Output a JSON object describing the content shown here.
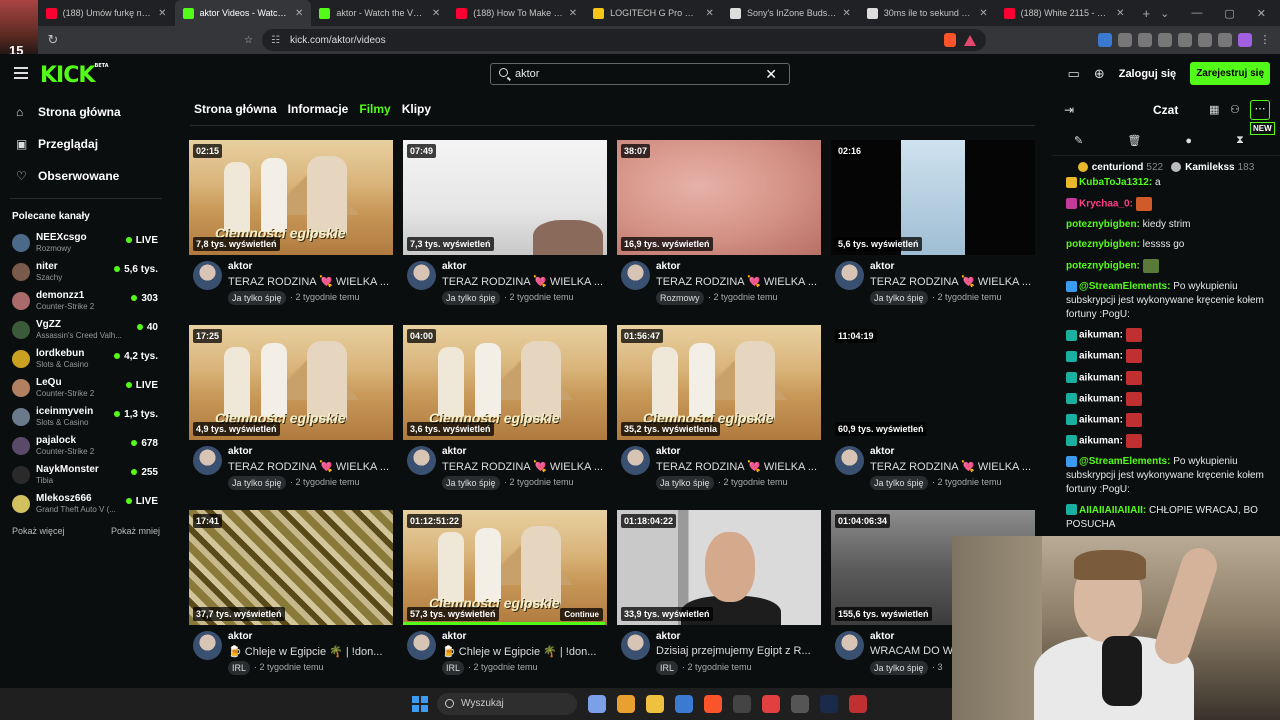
{
  "browser": {
    "tabs": [
      {
        "title": "(188) Umów furkę na najlepsze",
        "color": "#ff0033",
        "active": false
      },
      {
        "title": "aktor Videos - Watch On",
        "color": "#53fc18",
        "active": true
      },
      {
        "title": "aktor - Watch the VOD on Kick",
        "color": "#53fc18",
        "active": false
      },
      {
        "title": "(188) How To Make Ribs on a",
        "color": "#ff0033",
        "active": false
      },
      {
        "title": "LOGITECH G Pro X 2 Bezprzew",
        "color": "#f5c518",
        "active": false
      },
      {
        "title": "Sony's InZone Buds jakie mają",
        "color": "#dddddd",
        "active": false
      },
      {
        "title": "30ms ile to sekund - Google S",
        "color": "#dddddd",
        "active": false
      },
      {
        "title": "(188) White 2115 - RED FLAG",
        "color": "#ff0033",
        "active": false
      }
    ],
    "avatar_level": "15",
    "url": "kick.com/aktor/videos"
  },
  "header": {
    "logo": "KICK",
    "logo_beta": "BETA",
    "search_value": "aktor",
    "login": "Zaloguj się",
    "signup": "Zarejestruj się"
  },
  "sidebar": {
    "nav": [
      {
        "icon": "home-icon",
        "label": "Strona główna",
        "glyph": "⌂"
      },
      {
        "icon": "browse-icon",
        "label": "Przeglądaj",
        "glyph": "▣"
      },
      {
        "icon": "heart-icon",
        "label": "Obserwowane",
        "glyph": "♡"
      }
    ],
    "section_title": "Polecane kanały",
    "channels": [
      {
        "name": "NEEXcsgo",
        "game": "Rozmowy",
        "viewers": "LIVE",
        "color": "#4a6a8a"
      },
      {
        "name": "niter",
        "game": "Szachy",
        "viewers": "5,6 tys.",
        "color": "#7a5a4a"
      },
      {
        "name": "demonzz1",
        "game": "Counter-Strike 2",
        "viewers": "303",
        "color": "#a86a6a"
      },
      {
        "name": "VgZZ",
        "game": "Assassin's Creed Valh...",
        "viewers": "40",
        "color": "#3a5a3a"
      },
      {
        "name": "lordkebun",
        "game": "Slots & Casino",
        "viewers": "4,2 tys.",
        "color": "#c9a020"
      },
      {
        "name": "LeQu",
        "game": "Counter-Strike 2",
        "viewers": "LIVE",
        "color": "#b08060"
      },
      {
        "name": "iceinmyvein",
        "game": "Slots & Casino",
        "viewers": "1,3 tys.",
        "color": "#6a7a8a"
      },
      {
        "name": "pajalock",
        "game": "Counter-Strike 2",
        "viewers": "678",
        "color": "#5a4a6a"
      },
      {
        "name": "NaykMonster",
        "game": "Tibia",
        "viewers": "255",
        "color": "#2a2a2a"
      },
      {
        "name": "Mlekosz666",
        "game": "Grand Theft Auto V (...",
        "viewers": "LIVE",
        "color": "#d0c060"
      }
    ],
    "show_more": "Pokaż więcej",
    "show_less": "Pokaż mniej"
  },
  "content_tabs": [
    "Strona główna",
    "Informacje",
    "Filmy",
    "Klipy"
  ],
  "active_tab": "Filmy",
  "videos": [
    {
      "duration": "02:15",
      "views": "7,8 tys. wyświetleń",
      "channel": "aktor",
      "title": "TERAZ RODZINA 💘 WIELKA ...",
      "category": "Ja tylko śpię",
      "age": "2 tygodnie temu",
      "thumb": "pyr",
      "caption": "Ciemności egipskie"
    },
    {
      "duration": "07:49",
      "views": "7,3 tys. wyświetleń",
      "channel": "aktor",
      "title": "TERAZ RODZINA 💘 WIELKA ...",
      "category": "Ja tylko śpię",
      "age": "2 tygodnie temu",
      "thumb": "white"
    },
    {
      "duration": "38:07",
      "views": "16,9 tys. wyświetleń",
      "channel": "aktor",
      "title": "TERAZ RODZINA 💘 WIELKA ...",
      "category": "Rozmowy",
      "age": "2 tygodnie temu",
      "thumb": "skin"
    },
    {
      "duration": "02:16",
      "views": "5,6 tys. wyświetleń",
      "channel": "aktor",
      "title": "TERAZ RODZINA 💘 WIELKA ...",
      "category": "Ja tylko śpię",
      "age": "2 tygodnie temu",
      "thumb": "dark"
    },
    {
      "duration": "17:25",
      "views": "4,9 tys. wyświetleń",
      "channel": "aktor",
      "title": "TERAZ RODZINA 💘 WIELKA ...",
      "category": "Ja tylko śpię",
      "age": "2 tygodnie temu",
      "thumb": "pyr",
      "caption": "Ciemności egipskie"
    },
    {
      "duration": "04:00",
      "views": "3,6 tys. wyświetleń",
      "channel": "aktor",
      "title": "TERAZ RODZINA 💘 WIELKA ...",
      "category": "Ja tylko śpię",
      "age": "2 tygodnie temu",
      "thumb": "pyr",
      "caption": "Ciemności egipskie"
    },
    {
      "duration": "01:56:47",
      "views": "35,2 tys. wyświetlenia",
      "channel": "aktor",
      "title": "TERAZ RODZINA 💘 WIELKA ...",
      "category": "Ja tylko śpię",
      "age": "2 tygodnie temu",
      "thumb": "pyr",
      "caption": "Ciemności egipskie"
    },
    {
      "duration": "11:04:19",
      "views": "60,9 tys. wyświetleń",
      "channel": "aktor",
      "title": "TERAZ RODZINA 💘 WIELKA ...",
      "category": "Ja tylko śpię",
      "age": "2 tygodnie temu",
      "thumb": "black"
    },
    {
      "duration": "17:41",
      "views": "37,7 tys. wyświetleń",
      "channel": "aktor",
      "title": "🍺 Chleje w Egipcie 🌴 | !don...",
      "category": "IRL",
      "age": "2 tygodnie temu",
      "thumb": "glitch"
    },
    {
      "duration": "01:12:51:22",
      "views": "57,3 tys. wyświetleń",
      "channel": "aktor",
      "title": "🍺 Chleje w Egipcie 🌴 | !don...",
      "category": "IRL",
      "age": "2 tygodnie temu",
      "thumb": "pyr",
      "caption": "Ciemności egipskie",
      "continue": "Continue",
      "progress": 0.99
    },
    {
      "duration": "01:18:04:22",
      "views": "33,9 tys. wyświetleń",
      "channel": "aktor",
      "title": "Dzisiaj przejmujemy Egipt z R...",
      "category": "IRL",
      "age": "2 tygodnie temu",
      "thumb": "face"
    },
    {
      "duration": "01:04:06:34",
      "views": "155,6 tys. wyświetleń",
      "channel": "aktor",
      "title": "WRACAM DO W...",
      "category": "Ja tylko śpię",
      "age": "3",
      "thumb": "room"
    }
  ],
  "chat": {
    "title": "Czat",
    "new_tag": "NEW",
    "gifters": [
      {
        "name": "centuriond",
        "count": "522",
        "color": "#e8b82a"
      },
      {
        "name": "Kamilekss",
        "count": "183",
        "color": "#bbbbbb"
      }
    ],
    "messages": [
      {
        "user": "KubaToJa1312",
        "user_color": "#53fc18",
        "text": "a",
        "badge": "#e8b82a"
      },
      {
        "user": "Krychaa_0",
        "user_color": "#ff3c8a",
        "text": "",
        "badge": "#c43a9a",
        "emote": "#d05a2a"
      },
      {
        "user": "poteznybigben",
        "user_color": "#53fc18",
        "text": "kiedy strim"
      },
      {
        "user": "poteznybigben",
        "user_color": "#53fc18",
        "text": "lessss go"
      },
      {
        "user": "poteznybigben",
        "user_color": "#53fc18",
        "text": "",
        "emote": "#5a7a3a"
      },
      {
        "user": "@StreamElements",
        "user_color": "#53fc18",
        "text": "Po wykupieniu subskrypcji jest wykonywane kręcenie kołem fortuny :PogU:",
        "badge": "#3a9bf0"
      },
      {
        "user": "aikuman",
        "user_color": "#ffffff",
        "text": "",
        "badge": "#1ab0a0",
        "emote": "#c03030"
      },
      {
        "user": "aikuman",
        "user_color": "#ffffff",
        "text": "",
        "badge": "#1ab0a0",
        "emote": "#c03030"
      },
      {
        "user": "aikuman",
        "user_color": "#ffffff",
        "text": "",
        "badge": "#1ab0a0",
        "emote": "#c03030"
      },
      {
        "user": "aikuman",
        "user_color": "#ffffff",
        "text": "",
        "badge": "#1ab0a0",
        "emote": "#c03030"
      },
      {
        "user": "aikuman",
        "user_color": "#ffffff",
        "text": "",
        "badge": "#1ab0a0",
        "emote": "#c03030"
      },
      {
        "user": "aikuman",
        "user_color": "#ffffff",
        "text": "",
        "badge": "#1ab0a0",
        "emote": "#c03030"
      },
      {
        "user": "@StreamElements",
        "user_color": "#53fc18",
        "text": "Po wykupieniu subskrypcji jest wykonywane kręcenie kołem fortuny :PogU:",
        "badge": "#3a9bf0"
      },
      {
        "user": "AIIAIIAIIAIIAII",
        "user_color": "#53fc18",
        "text": "CHŁOPIE WRACAJ, BO POSUCHA",
        "badge": "#1ab0a0"
      }
    ]
  },
  "taskbar": {
    "search_placeholder": "Wyszukaj",
    "apps": [
      "#7aa0e8",
      "#e8a030",
      "#f0c040",
      "#3a7ad0",
      "#fb542b",
      "#444444",
      "#e04040",
      "#555555",
      "#1a2a4a",
      "#c03030"
    ]
  }
}
